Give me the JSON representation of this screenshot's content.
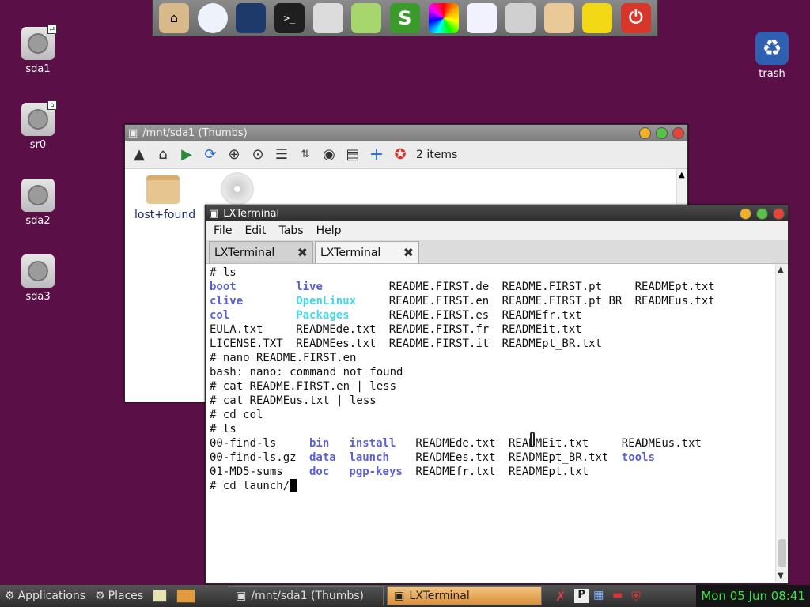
{
  "dock": {
    "items": [
      {
        "name": "home-folder"
      },
      {
        "name": "cloud"
      },
      {
        "name": "chat"
      },
      {
        "name": "terminal",
        "glyph": ">_"
      },
      {
        "name": "monitor"
      },
      {
        "name": "writer"
      },
      {
        "name": "spreadsheet",
        "glyph": "S"
      },
      {
        "name": "color-picker"
      },
      {
        "name": "document"
      },
      {
        "name": "mixer"
      },
      {
        "name": "folder"
      },
      {
        "name": "draw"
      },
      {
        "name": "power",
        "glyph": "⏻"
      }
    ]
  },
  "desktop": {
    "icons": [
      {
        "label": "sda1"
      },
      {
        "label": "sr0"
      },
      {
        "label": "sda2"
      },
      {
        "label": "sda3"
      },
      {
        "label": "trash"
      }
    ]
  },
  "file_manager": {
    "title": "/mnt/sda1 (Thumbs)",
    "item_count": "2 items",
    "items": [
      {
        "label": "lost+found"
      }
    ]
  },
  "terminal": {
    "title": "LXTerminal",
    "menu": [
      "File",
      "Edit",
      "Tabs",
      "Help"
    ],
    "tabs": [
      {
        "label": "LXTerminal"
      },
      {
        "label": "LXTerminal"
      }
    ],
    "lines": [
      [
        "# ls"
      ],
      [
        "boot",
        "live",
        "README.FIRST.de",
        "README.FIRST.pt",
        "READMEpt.txt"
      ],
      [
        "clive",
        "OpenLinux",
        "README.FIRST.en",
        "README.FIRST.pt_BR",
        "READMEus.txt"
      ],
      [
        "col",
        "Packages",
        "README.FIRST.es",
        "READMEfr.txt"
      ],
      [
        "EULA.txt",
        "READMEde.txt",
        "README.FIRST.fr",
        "READMEit.txt"
      ],
      [
        "LICENSE.TXT",
        "READMEes.txt",
        "README.FIRST.it",
        "READMEpt_BR.txt"
      ],
      [
        "# nano README.FIRST.en"
      ],
      [
        "bash: nano: command not found"
      ],
      [
        "# cat README.FIRST.en | less"
      ],
      [
        "# cat READMEus.txt | less"
      ],
      [
        "# cd col"
      ],
      [
        "# ls"
      ],
      [
        "00-find-ls",
        "bin",
        "install",
        "READMEde.txt",
        "READMEit.txt",
        "READMEus.txt"
      ],
      [
        "00-find-ls.gz",
        "data",
        "launch",
        "READMEes.txt",
        "READMEpt_BR.txt",
        "tools"
      ],
      [
        "01-MD5-sums",
        "doc",
        "pgp-keys",
        "READMEfr.txt",
        "READMEpt.txt"
      ],
      [
        "# cd launch/"
      ]
    ]
  },
  "taskbar": {
    "applications_label": "Applications",
    "places_label": "Places",
    "tasks": [
      {
        "label": "/mnt/sda1 (Thumbs)"
      },
      {
        "label": "LXTerminal"
      }
    ],
    "clock": "Mon 05 Jun 08:41"
  },
  "colors": {
    "desktop_bg": "#5b0f47",
    "dir": "#5b5fd6",
    "link": "#44d6e6",
    "clock_green": "#3fe04a"
  }
}
